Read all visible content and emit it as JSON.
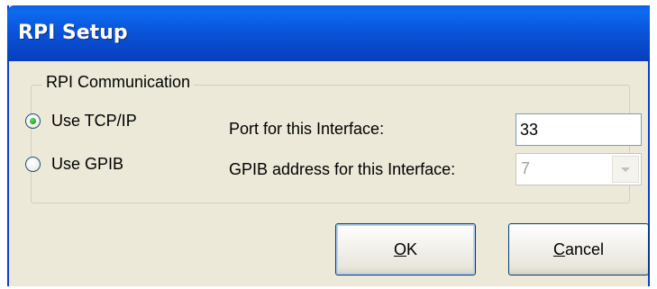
{
  "window": {
    "title": "RPI Setup"
  },
  "group": {
    "legend": "RPI Communication",
    "options": [
      {
        "label": "Use TCP/IP",
        "selected": true
      },
      {
        "label": "Use GPIB",
        "selected": false
      }
    ],
    "port_label": "Port for this Interface:",
    "port_value": "33",
    "gpib_label": "GPIB address for this Interface:",
    "gpib_value": "7",
    "gpib_enabled": false
  },
  "buttons": {
    "ok": {
      "mnemonic": "O",
      "rest": "K"
    },
    "cancel": {
      "mnemonic": "C",
      "rest": "ancel"
    }
  },
  "colors": {
    "titlebar": "#0a52d8",
    "dialog_bg": "#ece9d8",
    "radio_dot": "#21a121"
  }
}
